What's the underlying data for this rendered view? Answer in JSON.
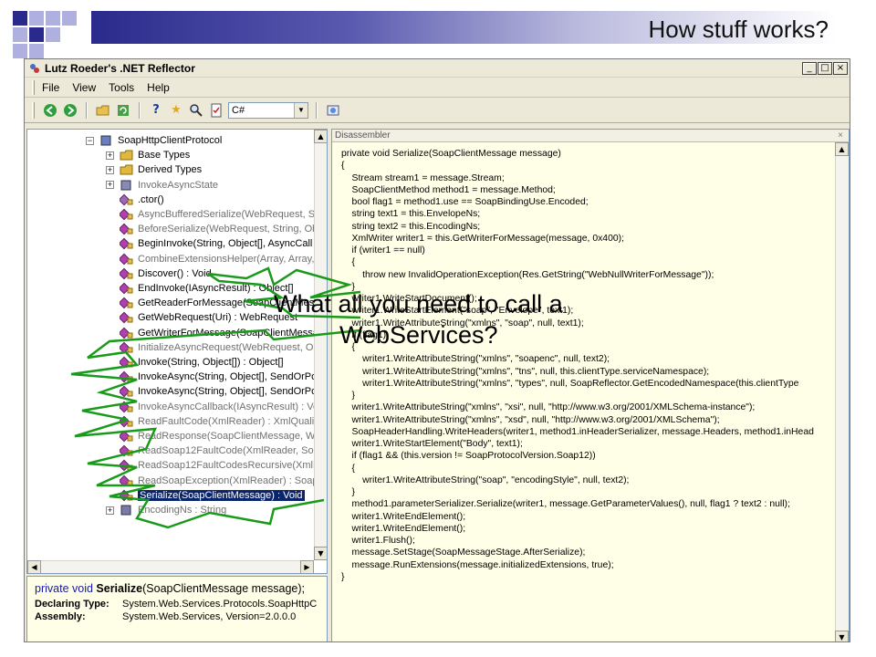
{
  "slide": {
    "title": "How stuff works?",
    "callout": [
      "What all you need to call a",
      "WebServices?"
    ],
    "colors": {
      "deco_dark": "#2a2a8c",
      "deco_light": "#b0b0e0",
      "arrow_green": "#1a9a1a"
    }
  },
  "window": {
    "title": "Lutz Roeder's .NET Reflector",
    "controls": [
      "_",
      "□",
      "×"
    ]
  },
  "menu": [
    "File",
    "View",
    "Tools",
    "Help"
  ],
  "toolbar": {
    "icons": [
      "back-icon",
      "forward-icon",
      "open-icon",
      "refresh-icon",
      "help-icon",
      "favorite-icon",
      "search-icon",
      "bookmark-icon",
      "dropdown-icon",
      "web-icon"
    ],
    "language": "C#"
  },
  "tree": {
    "rows": [
      {
        "label": "SoapHttpClientProtocol",
        "expander": "−",
        "icon": "class-icon",
        "indent": 0
      },
      {
        "label": "Base Types",
        "expander": "+",
        "icon": "folder-icon",
        "indent": 1
      },
      {
        "label": "Derived Types",
        "expander": "+",
        "icon": "folder-icon",
        "indent": 1
      },
      {
        "label": "InvokeAsyncState",
        "expander": "+",
        "icon": "nested-class-icon",
        "indent": 1,
        "gray": true
      },
      {
        "label": ".ctor()",
        "icon": "ctor-icon",
        "indent": 1
      },
      {
        "label": "AsyncBufferedSerialize(WebRequest, St",
        "icon": "method-icon",
        "indent": 1,
        "gray": true
      },
      {
        "label": "BeforeSerialize(WebRequest, String, Obj",
        "icon": "method-icon",
        "indent": 1,
        "gray": true
      },
      {
        "label": "BeginInvoke(String, Object[], AsyncCall",
        "icon": "method-icon",
        "indent": 1
      },
      {
        "label": "CombineExtensionsHelper(Array, Array,",
        "icon": "method-icon",
        "indent": 1,
        "gray": true
      },
      {
        "label": "Discover() : Void",
        "icon": "method-icon",
        "indent": 1
      },
      {
        "label": "EndInvoke(IAsyncResult) : Object[]",
        "icon": "method-icon",
        "indent": 1
      },
      {
        "label": "GetReaderForMessage(SoapClientMessag",
        "icon": "method-icon",
        "indent": 1
      },
      {
        "label": "GetWebRequest(Uri) : WebRequest",
        "icon": "method-icon",
        "indent": 1
      },
      {
        "label": "GetWriterForMessage(SoapClientMessag",
        "icon": "method-icon",
        "indent": 1
      },
      {
        "label": "InitializeAsyncRequest(WebRequest, Ob",
        "icon": "method-icon",
        "indent": 1,
        "gray": true
      },
      {
        "label": "Invoke(String, Object[]) : Object[]",
        "icon": "method-icon",
        "indent": 1
      },
      {
        "label": "InvokeAsync(String, Object[], SendOrPo",
        "icon": "method-icon",
        "indent": 1
      },
      {
        "label": "InvokeAsync(String, Object[], SendOrPo",
        "icon": "method-icon",
        "indent": 1
      },
      {
        "label": "InvokeAsyncCallback(IAsyncResult) : Vo",
        "icon": "method-icon",
        "indent": 1,
        "gray": true
      },
      {
        "label": "ReadFaultCode(XmlReader) : XmlQualifie",
        "icon": "method-icon",
        "indent": 1,
        "gray": true
      },
      {
        "label": "ReadResponse(SoapClientMessage, We",
        "icon": "method-icon",
        "indent": 1,
        "gray": true
      },
      {
        "label": "ReadSoap12FaultCode(XmlReader, Soap",
        "icon": "method-icon",
        "indent": 1,
        "gray": true
      },
      {
        "label": "ReadSoap12FaultCodesRecursive(XmlRe",
        "icon": "method-icon",
        "indent": 1,
        "gray": true
      },
      {
        "label": "ReadSoapException(XmlReader) : SoapE",
        "icon": "method-icon",
        "indent": 1,
        "gray": true
      },
      {
        "label": "Serialize(SoapClientMessage) : Void",
        "icon": "method-icon",
        "indent": 1,
        "selected": true
      },
      {
        "label": "EncodingNs : String",
        "expander": "+",
        "icon": "property-icon",
        "indent": 1,
        "gray": true
      }
    ]
  },
  "info": {
    "signature_prefix": "private void ",
    "signature_name": "Serialize",
    "signature_rest": "(SoapClientMessage message);",
    "rows": [
      {
        "key": "Declaring Type:",
        "value": "System.Web.Services.Protocols.SoapHttpC"
      },
      {
        "key": "Assembly:",
        "value": "System.Web.Services, Version=2.0.0.0"
      }
    ]
  },
  "disassembler": {
    "header": "Disassembler",
    "close": "×",
    "lines": [
      "private void Serialize(SoapClientMessage message)",
      "{",
      "    Stream stream1 = message.Stream;",
      "    SoapClientMethod method1 = message.Method;",
      "    bool flag1 = method1.use == SoapBindingUse.Encoded;",
      "    string text1 = this.EnvelopeNs;",
      "    string text2 = this.EncodingNs;",
      "    XmlWriter writer1 = this.GetWriterForMessage(message, 0x400);",
      "    if (writer1 == null)",
      "    {",
      "        throw new InvalidOperationException(Res.GetString(\"WebNullWriterForMessage\"));",
      "    }",
      "    writer1.WriteStartDocument();",
      "    writer1.WriteStartElement(\"soap\", \"Envelope\", text1);",
      "    writer1.WriteAttributeString(\"xmlns\", \"soap\", null, text1);",
      "    if (flag1)",
      "    {",
      "        writer1.WriteAttributeString(\"xmlns\", \"soapenc\", null, text2);",
      "        writer1.WriteAttributeString(\"xmlns\", \"tns\", null, this.clientType.serviceNamespace);",
      "        writer1.WriteAttributeString(\"xmlns\", \"types\", null, SoapReflector.GetEncodedNamespace(this.clientType",
      "    }",
      "    writer1.WriteAttributeString(\"xmlns\", \"xsi\", null, \"http://www.w3.org/2001/XMLSchema-instance\");",
      "    writer1.WriteAttributeString(\"xmlns\", \"xsd\", null, \"http://www.w3.org/2001/XMLSchema\");",
      "    SoapHeaderHandling.WriteHeaders(writer1, method1.inHeaderSerializer, message.Headers, method1.inHead",
      "    writer1.WriteStartElement(\"Body\", text1);",
      "    if (flag1 && (this.version != SoapProtocolVersion.Soap12))",
      "    {",
      "        writer1.WriteAttributeString(\"soap\", \"encodingStyle\", null, text2);",
      "    }",
      "    method1.parameterSerializer.Serialize(writer1, message.GetParameterValues(), null, flag1 ? text2 : null);",
      "    writer1.WriteEndElement();",
      "    writer1.WriteEndElement();",
      "    writer1.Flush();",
      "    message.SetStage(SoapMessageStage.AfterSerialize);",
      "    message.RunExtensions(message.initializedExtensions, true);",
      "}"
    ]
  }
}
